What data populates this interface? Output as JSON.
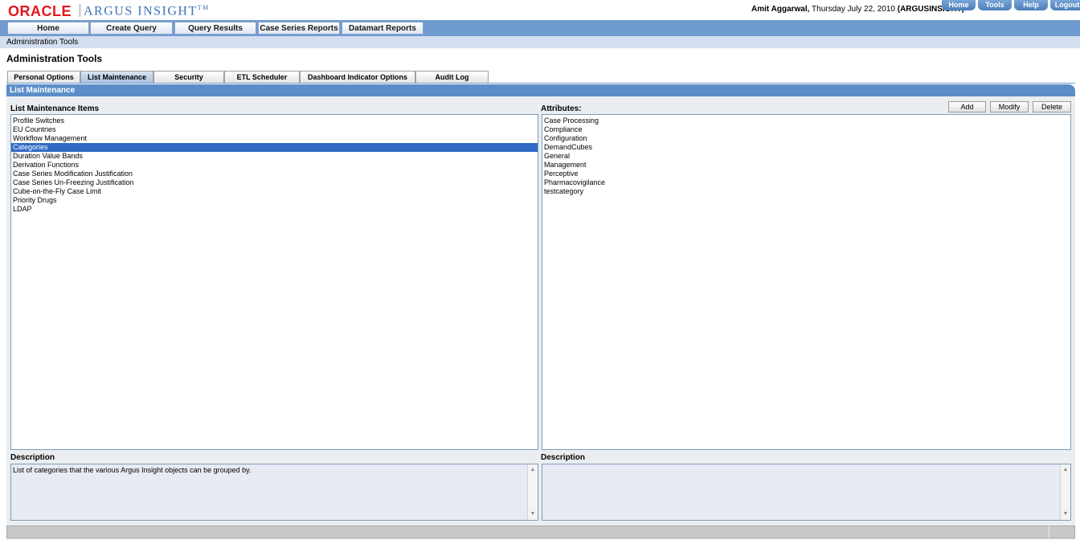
{
  "header": {
    "logo_oracle": "ORACLE",
    "logo_product": "ARGUS INSIGHT",
    "logo_tm": "TM",
    "user_name": "Amit Aggarwal,",
    "date_text": " Thursday July 22, 2010 ",
    "db_name": "(ARGUSINSIGHT)",
    "links": [
      "Home",
      "Tools",
      "Help",
      "Logout"
    ]
  },
  "nav": {
    "items": [
      "Home",
      "Create Query",
      "Query Results",
      "Case Series Reports",
      "Datamart Reports"
    ]
  },
  "breadcrumb": "Administration Tools",
  "page_title": "Administration Tools",
  "tabs": {
    "items": [
      "Personal Options",
      "List Maintenance",
      "Security",
      "ETL Scheduler",
      "Dashboard Indicator Options",
      "Audit Log"
    ],
    "active": "List Maintenance"
  },
  "section_title": "List Maintenance",
  "left_panel": {
    "label": "List Maintenance Items",
    "items": [
      "Profile Switches",
      "EU Countries",
      "Workflow Management",
      "Categories",
      "Duration Value Bands",
      "Derivation Functions",
      "Case Series Modification Justification",
      "Case Series Un-Freezing Justification",
      "Cube-on-the-Fly Case Limit",
      "Priority Drugs",
      "LDAP"
    ],
    "selected": "Categories",
    "description_label": "Description",
    "description_text": "List of categories that the various Argus Insight objects can be grouped by."
  },
  "right_panel": {
    "label": "Attributes:",
    "buttons": {
      "add": "Add",
      "modify": "Modify",
      "delete": "Delete"
    },
    "items": [
      "Case Processing",
      "Compliance",
      "Configuration",
      "DemandCubes",
      "General",
      "Management",
      "Perceptive",
      "Pharmacovigilance",
      "testcategory"
    ],
    "description_label": "Description",
    "description_text": ""
  },
  "icons": {
    "scroll_up": "scroll-up-arrow-icon",
    "scroll_down": "scroll-down-arrow-icon"
  },
  "colors": {
    "nav_bar": "#6f9bd0",
    "section_header": "#5b8ec9",
    "selection": "#316ac5",
    "oracle_red": "#e3171d"
  }
}
